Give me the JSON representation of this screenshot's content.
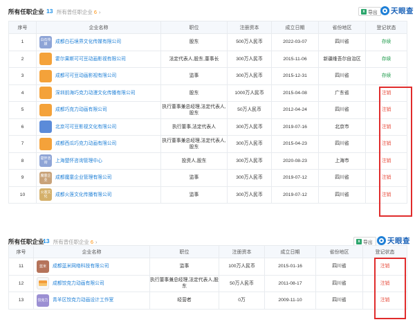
{
  "panel1": {
    "title": "所有任职企业",
    "count": "13",
    "sub_label": "所有曾任职企业",
    "sub_count": "6",
    "export_label": "导出",
    "brand": "天眼查",
    "columns": [
      "序号",
      "企业名称",
      "职位",
      "注册资本",
      "成立日期",
      "省份地区",
      "登记状态"
    ],
    "rows": [
      {
        "no": "1",
        "logo": "白石传媒",
        "logo_style": "lg-text",
        "name": "成都白石境界文化传媒有限公司",
        "position": "股东",
        "capital": "500万人民币",
        "date": "2022-03-07",
        "region": "四川省",
        "status": "存续",
        "status_type": "active"
      },
      {
        "no": "2",
        "logo": "",
        "logo_style": "lg-orange",
        "name": "霍尔果斯可可豆动画影视有限公司",
        "position": "法定代表人,股东,董事长",
        "capital": "300万人民币",
        "date": "2015-11-06",
        "region": "新疆维吾尔自治区",
        "status": "存续",
        "status_type": "active"
      },
      {
        "no": "3",
        "logo": "",
        "logo_style": "lg-orange",
        "name": "成都可可豆动画影视有限公司",
        "position": "监事",
        "capital": "300万人民币",
        "date": "2015-12-31",
        "region": "四川省",
        "status": "存续",
        "status_type": "active"
      },
      {
        "no": "4",
        "logo": "",
        "logo_style": "lg-orange",
        "name": "深圳前海巧克力动漫文化传播有限公司",
        "position": "股东",
        "capital": "1000万人民币",
        "date": "2015-04-08",
        "region": "广东省",
        "status": "注销",
        "status_type": "cancelled"
      },
      {
        "no": "5",
        "logo": "",
        "logo_style": "lg-orange",
        "name": "成都巧克力动画有限公司",
        "position": "执行董事兼总经理,法定代表人,股东",
        "capital": "50万人民币",
        "date": "2012-04-24",
        "region": "四川省",
        "status": "注销",
        "status_type": "cancelled"
      },
      {
        "no": "6",
        "logo": "",
        "logo_style": "lg-blue",
        "name": "北京可可豆影视文化有限公司",
        "position": "执行董事,法定代表人",
        "capital": "300万人民币",
        "date": "2019-07-16",
        "region": "北京市",
        "status": "注销",
        "status_type": "cancelled"
      },
      {
        "no": "7",
        "logo": "",
        "logo_style": "lg-orange",
        "name": "成都西瓜巧克力动画有限公司",
        "position": "执行董事兼总经理,法定代表人,股东",
        "capital": "300万人民币",
        "date": "2015-04-23",
        "region": "四川省",
        "status": "注销",
        "status_type": "cancelled"
      },
      {
        "no": "8",
        "logo": "楚怀咨询",
        "logo_style": "lg-text",
        "name": "上海楚怀咨询管理中心",
        "position": "投资人,股东",
        "capital": "300万人民币",
        "date": "2020-08-23",
        "region": "上海市",
        "status": "注销",
        "status_type": "cancelled"
      },
      {
        "no": "9",
        "logo": "魔童企业",
        "logo_style": "lg-text2",
        "name": "成都魔童企业管理有限公司",
        "position": "监事",
        "capital": "300万人民币",
        "date": "2019-07-12",
        "region": "四川省",
        "status": "注销",
        "status_type": "cancelled"
      },
      {
        "no": "10",
        "logo": "火莲文化",
        "logo_style": "lg-text3",
        "name": "成都火莲文化传播有限公司",
        "position": "监事",
        "capital": "300万人民币",
        "date": "2019-07-12",
        "region": "四川省",
        "status": "注销",
        "status_type": "cancelled"
      }
    ]
  },
  "panel2": {
    "title": "所有任职企业",
    "count": "13",
    "sub_label": "所有曾任职企业",
    "sub_count": "6",
    "export_label": "导出",
    "brand": "天眼查",
    "columns": [
      "序号",
      "企业名称",
      "职位",
      "注册资本",
      "成立日期",
      "省份地区",
      "登记状态"
    ],
    "rows": [
      {
        "no": "11",
        "logo": "蓝米",
        "logo_style": "lg-brown",
        "name": "成都蓝米网络科技有限公司",
        "position": "监事",
        "capital": "100万人民币",
        "date": "2015-01-16",
        "region": "四川省",
        "status": "注销",
        "status_type": "cancelled"
      },
      {
        "no": "12",
        "logo": "",
        "logo_style": "lg-flag",
        "name": "成都饺克力动画有限公司",
        "position": "执行董事兼总经理,法定代表人,股东",
        "capital": "50万人民币",
        "date": "2011-08-17",
        "region": "四川省",
        "status": "注销",
        "status_type": "cancelled"
      },
      {
        "no": "13",
        "logo": "饺克力",
        "logo_style": "lg-purple",
        "name": "青羊区饺克力动画设计工作室",
        "position": "经营者",
        "capital": "0万",
        "date": "2009-11-10",
        "region": "四川省",
        "status": "注销",
        "status_type": "cancelled"
      }
    ]
  },
  "colors": {
    "link": "#1e7fd6",
    "active": "#1e9b4b",
    "cancelled": "#e74c3c",
    "highlight_box": "#e02b2b",
    "count": "#1e8fe6",
    "sub_count": "#ff8c00"
  }
}
